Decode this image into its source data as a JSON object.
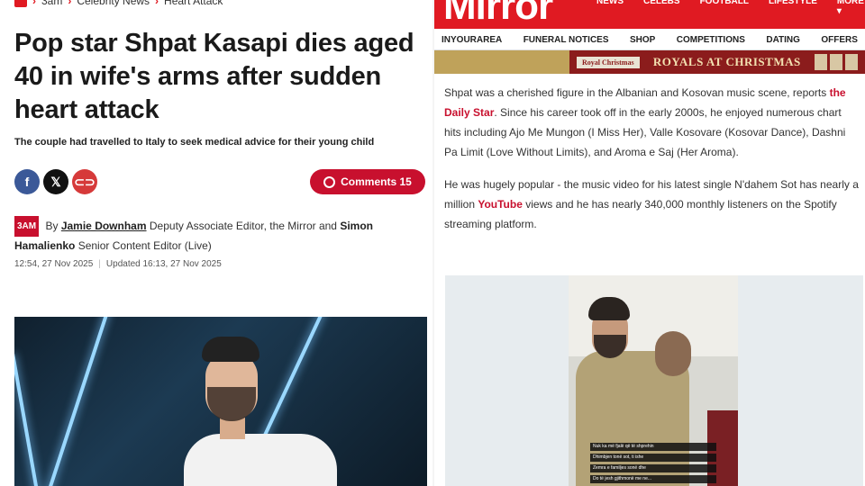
{
  "left": {
    "breadcrumb": [
      "3am",
      "Celebrity News",
      "Heart Attack"
    ],
    "headline": "Pop star Shpat Kasapi dies aged 40 in wife's arms after sudden heart attack",
    "subheadline": "The couple had travelled to Italy to seek medical advice for their young child",
    "share": {
      "facebook": "f",
      "x": "𝕏",
      "link": "⊂⊃"
    },
    "comments_label": "Comments 15",
    "byline": {
      "badge": "3AM",
      "by": "By",
      "author1": "Jamie Downham",
      "role1": "Deputy Associate Editor, the Mirror and",
      "author2": "Simon Hamalienko",
      "role2": "Senior Content Editor (Live)"
    },
    "published": "12:54, 27 Nov 2025",
    "updated": "Updated 16:13, 27 Nov 2025"
  },
  "right": {
    "brand": "Mirror",
    "top_nav": [
      "NEWS",
      "CELEBS",
      "FOOTBALL",
      "LIFESTYLE",
      "MORE ▾"
    ],
    "sub_nav": [
      "INYOURAREA",
      "FUNERAL NOTICES",
      "SHOP",
      "COMPETITIONS",
      "DATING",
      "OFFERS"
    ],
    "promo": {
      "badge": "Royal Christmas",
      "title": "ROYALS AT CHRISTMAS"
    },
    "para1": {
      "text_a": "Shpat was a cherished figure in the Albanian and Kosovan music scene, reports ",
      "link": "the Daily Star",
      "text_b": ". Since his career took off in the early 2000s, he enjoyed numerous chart hits including Ajo Me Mungon (I Miss Her), Valle Kosovare (Kosovar Dance), Dashni Pa Limit (Love Without Limits), and Aroma e Saj (Her Aroma)."
    },
    "para2": {
      "text_a": "He was hugely popular - the music video for his latest single N'dahem Sot has nearly a million ",
      "link": "YouTube",
      "text_b": " views and he has nearly 340,000 monthly listeners on the Spotify streaming platform."
    },
    "story_caption": [
      "Nuk ka më fjalë që të shprehin",
      "Dhimbjen tonë sot, ti ishe",
      "Zemra e familjes sonë dhe",
      "Do të jesh gjithmonë me ne..."
    ]
  }
}
